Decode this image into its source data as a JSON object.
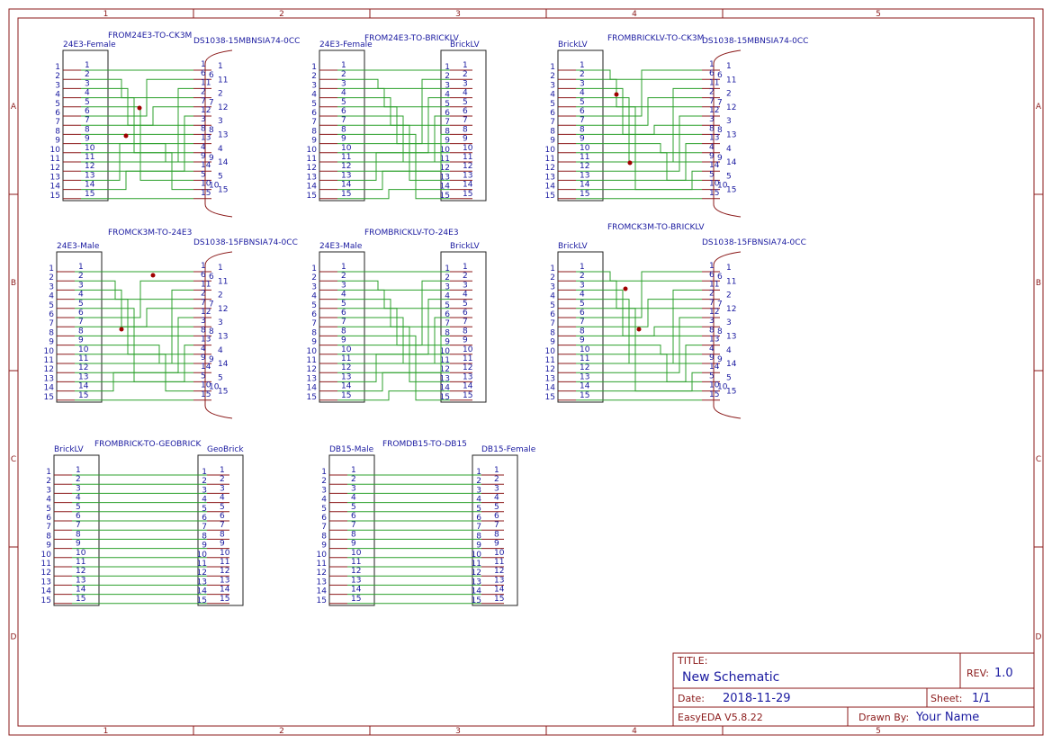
{
  "zones": {
    "columns": [
      "1",
      "2",
      "3",
      "4",
      "5"
    ],
    "rows": [
      "A",
      "B",
      "C",
      "D"
    ]
  },
  "title_block": {
    "title_label": "TITLE:",
    "title": "New Schematic",
    "rev_label": "REV:",
    "rev": "1.0",
    "date_label": "Date:",
    "date": "2018-11-29",
    "sheet_label": "Sheet:",
    "sheet": "1/1",
    "tool": "EasyEDA V5.8.22",
    "drawn_label": "Drawn By:",
    "drawn_by": "Your Name"
  },
  "blocks": [
    {
      "title": "FROM24E3-TO-CK3M",
      "left": "24E3-Female",
      "right": "DS1038-15MBNSIA74-0CC",
      "right_type": "dsub"
    },
    {
      "title": "FROM24E3-TO-BRICKLV",
      "left": "24E3-Female",
      "right": "BrickLV",
      "right_type": "box"
    },
    {
      "title": "FROMBRICKLV-TO-CK3M",
      "left": "BrickLV",
      "right": "DS1038-15MBNSIA74-0CC",
      "right_type": "dsub"
    },
    {
      "title": "FROMCK3M-TO-24E3",
      "left": "24E3-Male",
      "right": "DS1038-15FBNSIA74-0CC",
      "right_type": "dsub"
    },
    {
      "title": "FROMBRICKLV-TO-24E3",
      "left": "24E3-Male",
      "right": "BrickLV",
      "right_type": "box"
    },
    {
      "title": "FROMCK3M-TO-BRICKLV",
      "left": "BrickLV",
      "right": "DS1038-15FBNSIA74-0CC",
      "right_type": "dsub"
    },
    {
      "title": "FROMBRICK-TO-GEOBRICK",
      "left": "BrickLV",
      "right": "GeoBrick",
      "right_type": "box"
    },
    {
      "title": "FROMDB15-TO-DB15",
      "left": "DB15-Male",
      "right": "DB15-Female",
      "right_type": "box"
    }
  ],
  "pin_numbers": [
    "1",
    "2",
    "3",
    "4",
    "5",
    "6",
    "7",
    "8",
    "9",
    "10",
    "11",
    "12",
    "13",
    "14",
    "15"
  ],
  "dsub_pin_labels": [
    "1",
    "6",
    "11",
    "2",
    "7",
    "12",
    "3",
    "8",
    "13",
    "4",
    "9",
    "14",
    "5",
    "10",
    "15"
  ],
  "dsub_outer_labels": [
    "1",
    "11",
    "2",
    "12",
    "3",
    "13",
    "4",
    "14",
    "5",
    "15"
  ],
  "dsub_inner_labels": [
    "6",
    "7",
    "8",
    "9",
    "10"
  ]
}
